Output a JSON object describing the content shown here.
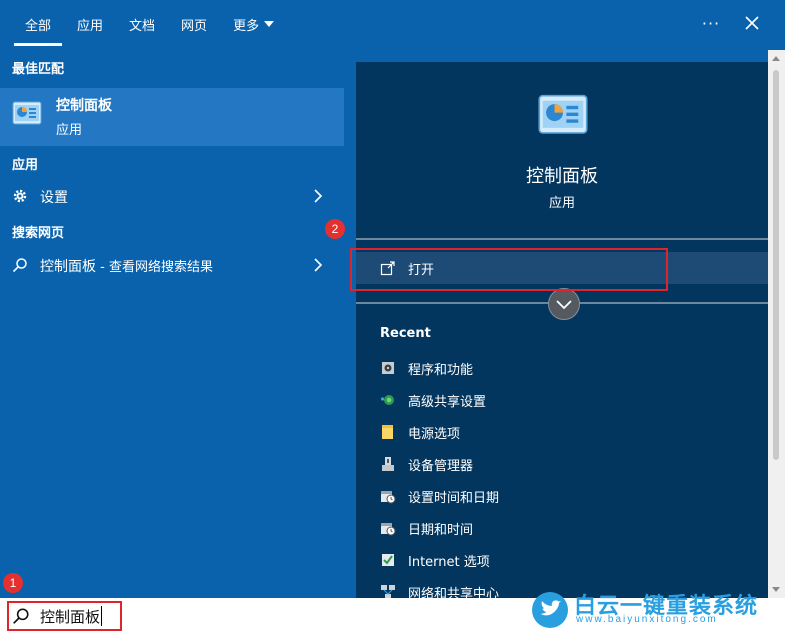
{
  "tabs": [
    {
      "label": "全部",
      "active": true
    },
    {
      "label": "应用",
      "active": false
    },
    {
      "label": "文档",
      "active": false
    },
    {
      "label": "网页",
      "active": false
    },
    {
      "label": "更多",
      "active": false
    }
  ],
  "header": {
    "more_options": "···"
  },
  "left": {
    "best_match_title": "最佳匹配",
    "best_match": {
      "name": "控制面板",
      "type": "应用"
    },
    "apps_title": "应用",
    "apps": [
      {
        "label": "设置",
        "icon": "gear-icon"
      }
    ],
    "web_title": "搜索网页",
    "web": [
      {
        "label": "控制面板",
        "hint": " - 查看网络搜索结果",
        "icon": "search-icon"
      }
    ]
  },
  "right": {
    "title": "控制面板",
    "subtitle": "应用",
    "open_label": "打开",
    "recent_title": "Recent",
    "recent": [
      {
        "label": "程序和功能",
        "icon": "programs-icon"
      },
      {
        "label": "高级共享设置",
        "icon": "network-sharing-icon"
      },
      {
        "label": "电源选项",
        "icon": "power-options-icon"
      },
      {
        "label": "设备管理器",
        "icon": "device-manager-icon"
      },
      {
        "label": "设置时间和日期",
        "icon": "clock-icon"
      },
      {
        "label": "日期和时间",
        "icon": "calendar-icon"
      },
      {
        "label": "Internet 选项",
        "icon": "internet-options-icon"
      },
      {
        "label": "网络和共享中心",
        "icon": "network-center-icon"
      }
    ]
  },
  "search": {
    "value": "控制面板"
  },
  "annotations": {
    "badge1": "1",
    "badge2": "2"
  },
  "watermark": {
    "text": "白云一键重装系统",
    "url": "www.baiyunxitong.com"
  },
  "colors": {
    "panel": "#0a62ad",
    "detail": "#03365f",
    "highlight": "#2377c3",
    "annotation": "#e0242b"
  }
}
